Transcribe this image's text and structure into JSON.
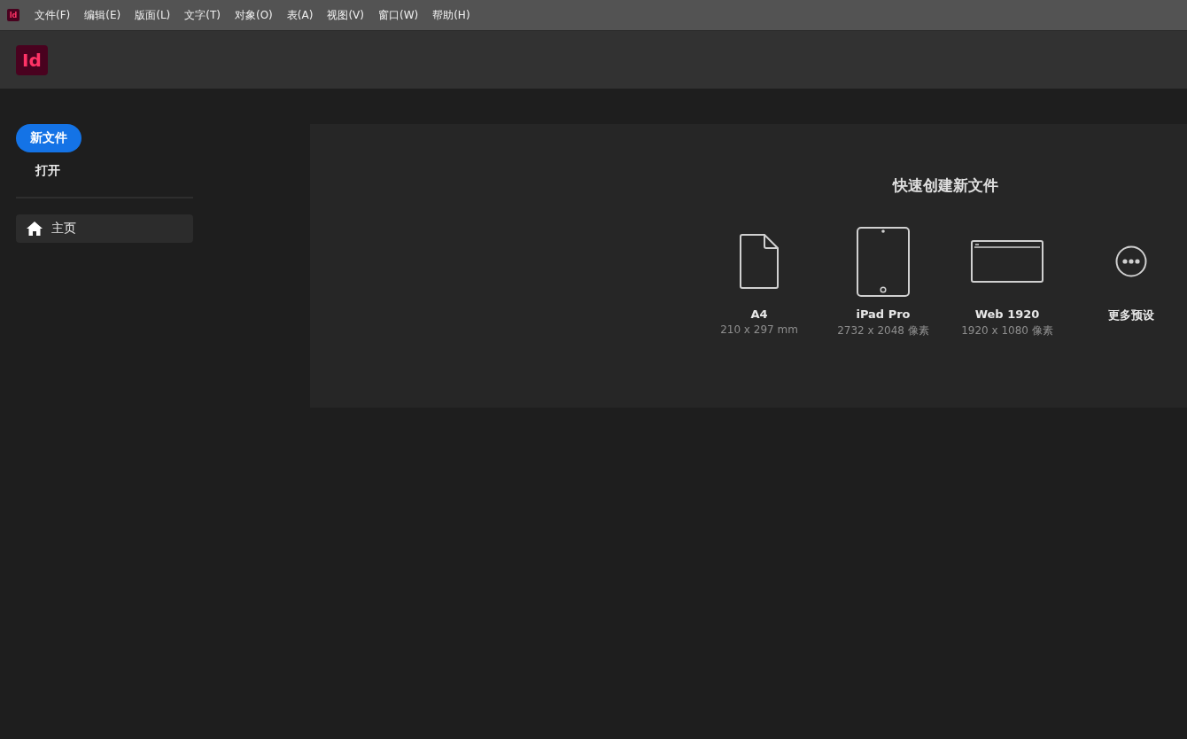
{
  "app_icon": {
    "label": "Id"
  },
  "menu": [
    "文件(F)",
    "编辑(E)",
    "版面(L)",
    "文字(T)",
    "对象(O)",
    "表(A)",
    "视图(V)",
    "窗口(W)",
    "帮助(H)"
  ],
  "header": {
    "logo": "Id"
  },
  "sidebar": {
    "new_button": "新文件",
    "open_button": "打开",
    "nav": [
      {
        "label": "主页",
        "selected": true
      }
    ]
  },
  "quick_create": {
    "title": "快速创建新文件",
    "presets": [
      {
        "kind": "document",
        "name": "A4",
        "size": "210 x 297 mm"
      },
      {
        "kind": "tablet",
        "name": "iPad Pro",
        "size": "2732 x 2048 像素"
      },
      {
        "kind": "web",
        "name": "Web 1920",
        "size": "1920 x 1080 像素"
      },
      {
        "kind": "more",
        "name": "更多预设"
      }
    ]
  }
}
